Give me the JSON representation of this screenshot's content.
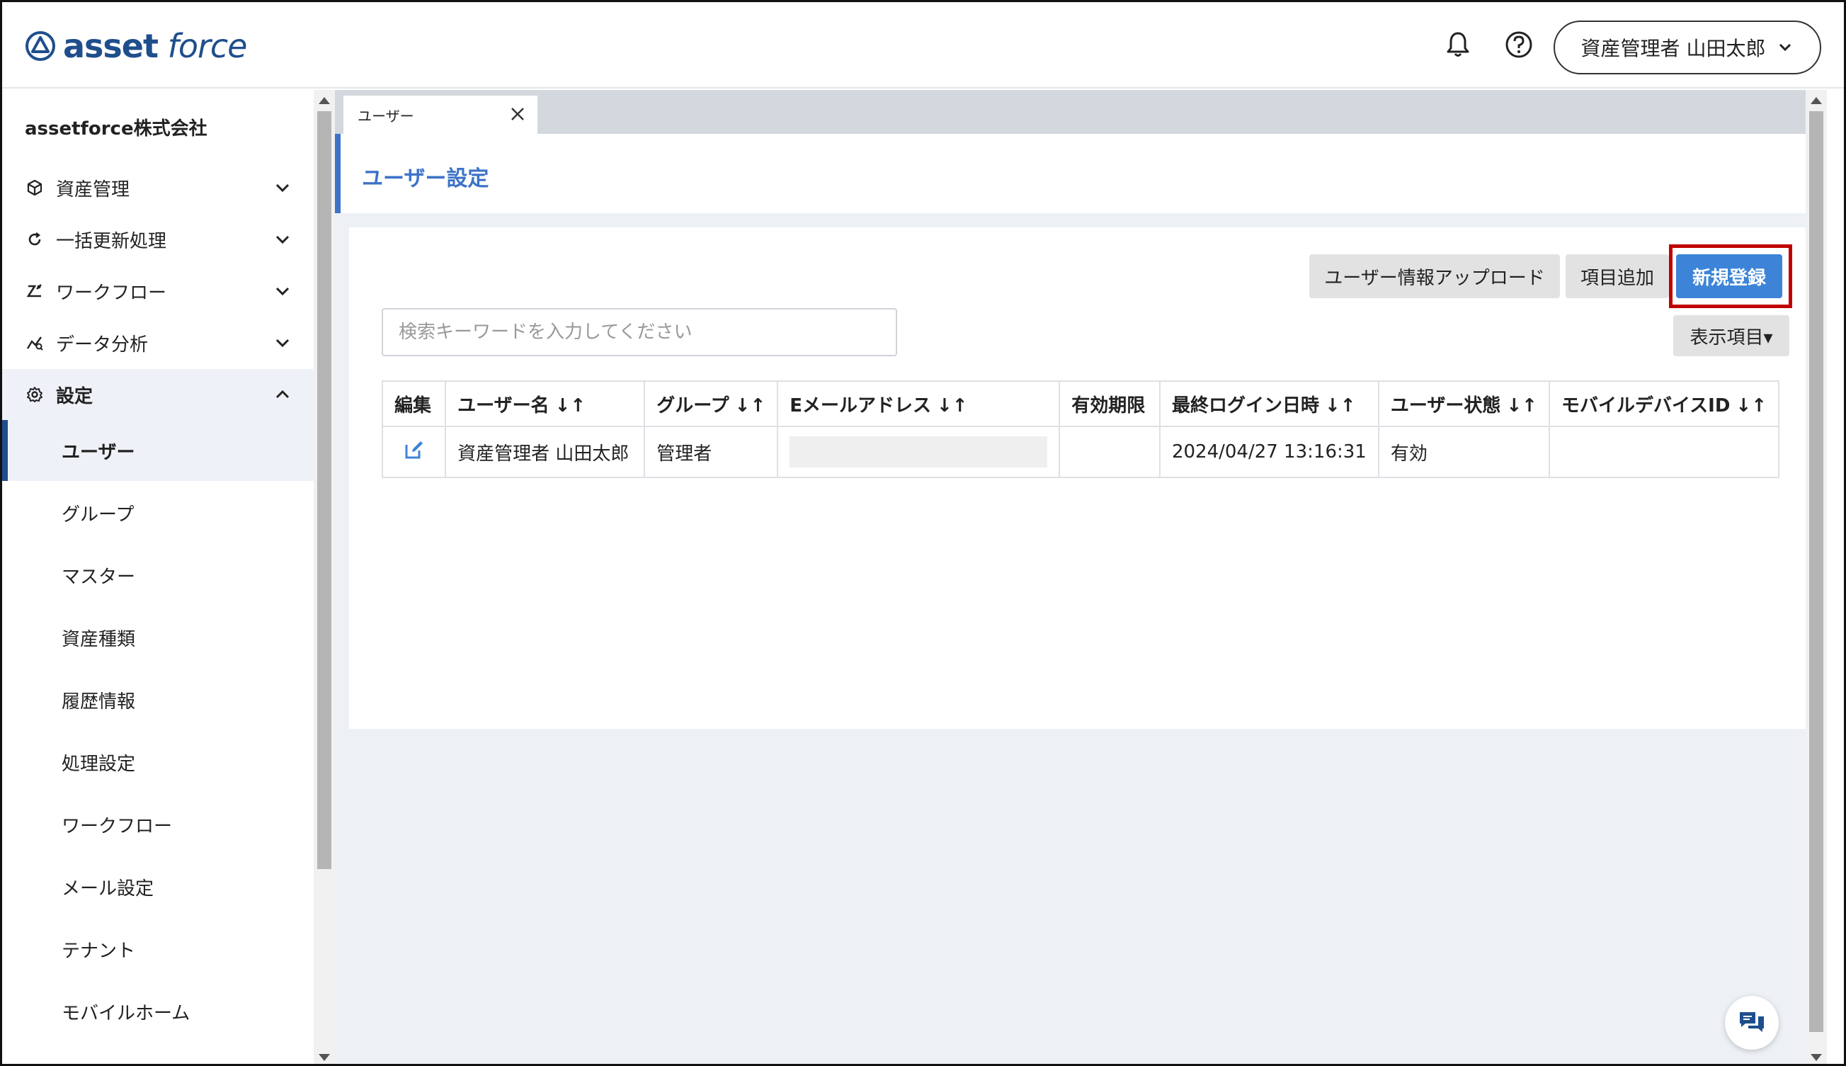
{
  "header": {
    "logo_text_bold": "asset",
    "logo_text_italic": "force",
    "user_menu_label": "資産管理者 山田太郎"
  },
  "sidebar": {
    "company": "assetforce株式会社",
    "nav": [
      {
        "label": "資産管理",
        "icon": "cube-icon"
      },
      {
        "label": "一括更新処理",
        "icon": "refresh-icon"
      },
      {
        "label": "ワークフロー",
        "icon": "workflow-icon"
      },
      {
        "label": "データ分析",
        "icon": "analytics-icon"
      },
      {
        "label": "設定",
        "icon": "gear-icon"
      }
    ],
    "settings_items": [
      "ユーザー",
      "グループ",
      "マスター",
      "資産種類",
      "履歴情報",
      "処理設定",
      "ワークフロー",
      "メール設定",
      "テナント",
      "モバイルホーム"
    ]
  },
  "tab": {
    "label": "ユーザー"
  },
  "page": {
    "title": "ユーザー設定"
  },
  "toolbar": {
    "upload_label": "ユーザー情報アップロード",
    "add_field_label": "項目追加",
    "new_label": "新規登録",
    "display_items_label": "表示項目▾"
  },
  "search": {
    "placeholder": "検索キーワードを入力してください"
  },
  "table": {
    "headers": [
      "編集",
      "ユーザー名",
      "グループ",
      "Eメールアドレス",
      "有効期限",
      "最終ログイン日時",
      "ユーザー状態",
      "モバイルデバイスID"
    ],
    "sort_glyph": "↓↑",
    "rows": [
      {
        "user_name": "資産管理者 山田太郎",
        "group": "管理者",
        "email": "",
        "expiry": "",
        "last_login": "2024/04/27 13:16:31",
        "status": "有効",
        "device_id": ""
      }
    ]
  },
  "colors": {
    "brand": "#1f4e8c",
    "accent": "#3d84d8",
    "highlight": "#c00000"
  }
}
